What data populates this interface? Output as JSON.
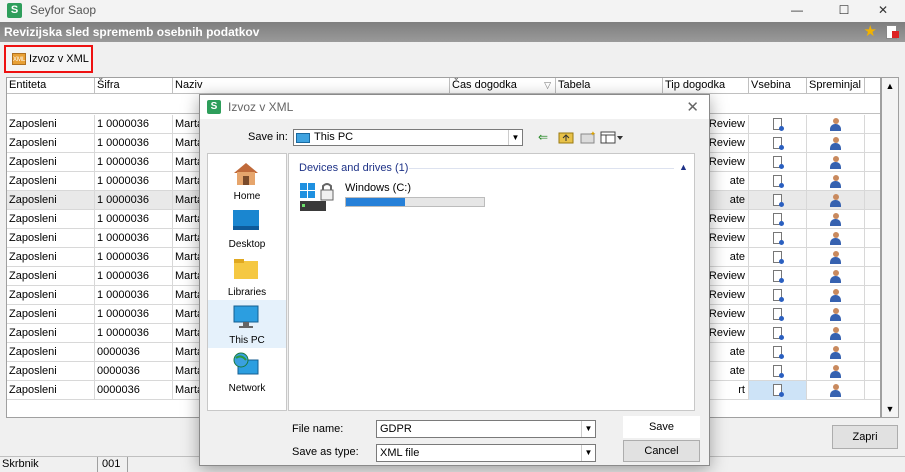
{
  "app": {
    "title": "Seyfor Saop",
    "logo_letter": "S"
  },
  "window_controls": {
    "minimize": "—",
    "maximize": "☐",
    "close": "✕"
  },
  "page": {
    "title": "Revizijska sled sprememb osebnih podatkov"
  },
  "toolbar": {
    "export_label": "Izvoz v XML",
    "export_icon_text": "XML"
  },
  "grid": {
    "columns": [
      "Entiteta",
      "Šifra",
      "Naziv",
      "Čas dogodka",
      "Tabela",
      "Tip dogodka",
      "Vsebina",
      "Spreminjal"
    ],
    "sort_indicator": "▽",
    "rows": [
      {
        "entiteta": "Zaposleni",
        "sifra": "1 0000036",
        "naziv": "Marta",
        "tip": "LogReview"
      },
      {
        "entiteta": "Zaposleni",
        "sifra": "1 0000036",
        "naziv": "Marta",
        "tip": "LogReview"
      },
      {
        "entiteta": "Zaposleni",
        "sifra": "1 0000036",
        "naziv": "Marta",
        "tip": "LogReview"
      },
      {
        "entiteta": "Zaposleni",
        "sifra": "1 0000036",
        "naziv": "Marta",
        "tip": "ate"
      },
      {
        "entiteta": "Zaposleni",
        "sifra": "1 0000036",
        "naziv": "Marta",
        "tip": "ate"
      },
      {
        "entiteta": "Zaposleni",
        "sifra": "1 0000036",
        "naziv": "Marta",
        "tip": "LogReview"
      },
      {
        "entiteta": "Zaposleni",
        "sifra": "1 0000036",
        "naziv": "Marta",
        "tip": "LogReview"
      },
      {
        "entiteta": "Zaposleni",
        "sifra": "1 0000036",
        "naziv": "Marta",
        "tip": "ate"
      },
      {
        "entiteta": "Zaposleni",
        "sifra": "1 0000036",
        "naziv": "Marta",
        "tip": "LogReview"
      },
      {
        "entiteta": "Zaposleni",
        "sifra": "1 0000036",
        "naziv": "Marta",
        "tip": "LogReview"
      },
      {
        "entiteta": "Zaposleni",
        "sifra": "1 0000036",
        "naziv": "Marta",
        "tip": "LogReview"
      },
      {
        "entiteta": "Zaposleni",
        "sifra": "1 0000036",
        "naziv": "Marta",
        "tip": "LogReview"
      },
      {
        "entiteta": "Zaposleni",
        "sifra": "0000036",
        "naziv": "Marta",
        "tip": "ate"
      },
      {
        "entiteta": "Zaposleni",
        "sifra": "0000036",
        "naziv": "Marta",
        "tip": "ate"
      },
      {
        "entiteta": "Zaposleni",
        "sifra": "0000036",
        "naziv": "Marta",
        "tip": "rt"
      }
    ]
  },
  "buttons": {
    "close": "Zapri"
  },
  "statusbar": {
    "user": "Skrbnik",
    "company": "001"
  },
  "dialog": {
    "title": "Izvoz v XML",
    "logo_letter": "S",
    "close": "✕",
    "save_in_label": "Save in:",
    "save_in_value": "This PC",
    "places": [
      "Home",
      "Desktop",
      "Libraries",
      "This PC",
      "Network"
    ],
    "group_title": "Devices and drives (1)",
    "drive_name": "Windows (C:)",
    "drive_used_fraction": 0.43,
    "file_name_label": "File name:",
    "file_name_value": "GDPR",
    "save_type_label": "Save as type:",
    "save_type_value": "XML file",
    "save_button": "Save",
    "cancel_button": "Cancel"
  },
  "colors": {
    "highlight_border": "#e11111",
    "accent": "#2680d8",
    "logo": "#2e9e5b"
  }
}
